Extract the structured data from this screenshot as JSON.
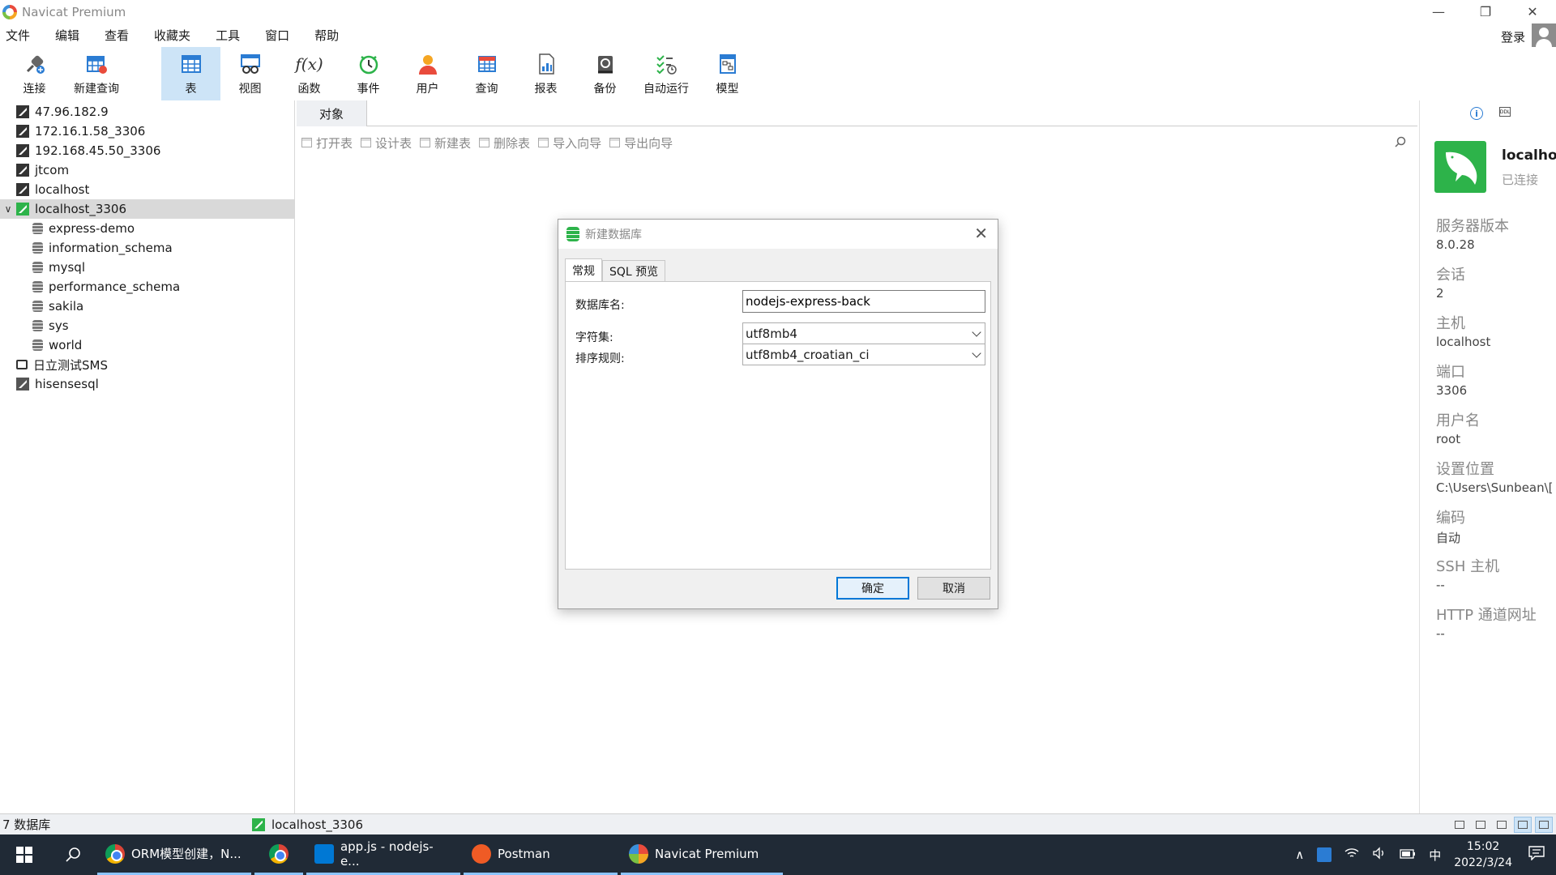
{
  "app": {
    "title": "Navicat Premium"
  },
  "window_controls": {
    "minimize": "—",
    "restore": "❐",
    "close": "✕"
  },
  "menu": {
    "items": [
      "文件",
      "编辑",
      "查看",
      "收藏夹",
      "工具",
      "窗口",
      "帮助"
    ],
    "login": "登录"
  },
  "toolbar": {
    "items": [
      {
        "label": "连接",
        "icon": "plug-icon"
      },
      {
        "label": "新建查询",
        "icon": "new-query-icon"
      },
      {
        "label": "表",
        "icon": "table-icon"
      },
      {
        "label": "视图",
        "icon": "view-icon"
      },
      {
        "label": "函数",
        "icon": "function-icon"
      },
      {
        "label": "事件",
        "icon": "clock-icon"
      },
      {
        "label": "用户",
        "icon": "user-icon"
      },
      {
        "label": "查询",
        "icon": "query-icon"
      },
      {
        "label": "报表",
        "icon": "report-icon"
      },
      {
        "label": "备份",
        "icon": "backup-icon"
      },
      {
        "label": "自动运行",
        "icon": "schedule-icon"
      },
      {
        "label": "模型",
        "icon": "model-icon"
      }
    ],
    "function_glyph": "f(x)"
  },
  "tree": {
    "connections": [
      "47.96.182.9",
      "172.16.1.58_3306",
      "192.168.45.50_3306",
      "jtcom",
      "localhost"
    ],
    "selected_connection": "localhost_3306",
    "databases": [
      "express-demo",
      "information_schema",
      "mysql",
      "performance_schema",
      "sakila",
      "sys",
      "world"
    ],
    "other_connections": [
      "日立测试SMS",
      "hisensesql"
    ]
  },
  "objects": {
    "tab_label": "对象",
    "actions": [
      "打开表",
      "设计表",
      "新建表",
      "删除表",
      "导入向导",
      "导出向导"
    ]
  },
  "info_panel": {
    "conn_name": "localho",
    "conn_status": "已连接",
    "items": [
      {
        "key": "服务器版本",
        "value": "8.0.28"
      },
      {
        "key": "会话",
        "value": "2"
      },
      {
        "key": "主机",
        "value": "localhost"
      },
      {
        "key": "端口",
        "value": "3306"
      },
      {
        "key": "用户名",
        "value": "root"
      },
      {
        "key": "设置位置",
        "value": "C:\\Users\\Sunbean\\["
      },
      {
        "key": "编码",
        "value": "自动"
      },
      {
        "key": "SSH 主机",
        "value": "--"
      },
      {
        "key": "HTTP 通道网址",
        "value": "--"
      }
    ]
  },
  "dialog": {
    "title": "新建数据库",
    "tabs": [
      "常规",
      "SQL 预览"
    ],
    "db_name_label": "数据库名:",
    "db_name_value": "nodejs-express-back",
    "charset_label": "字符集:",
    "charset_value": "utf8mb4",
    "collation_label": "排序规则:",
    "collation_value": "utf8mb4_croatian_ci",
    "ok": "确定",
    "cancel": "取消"
  },
  "statusbar": {
    "count": "7 数据库",
    "connection": "localhost_3306"
  },
  "taskbar": {
    "tasks": [
      {
        "label": "ORM模型创建，N...",
        "icon": "chrome-icon"
      },
      {
        "label": "",
        "icon": "chrome-icon"
      },
      {
        "label": "app.js - nodejs-e...",
        "icon": "vscode-icon"
      },
      {
        "label": "Postman",
        "icon": "postman-icon"
      },
      {
        "label": "Navicat Premium",
        "icon": "navicat-icon"
      }
    ],
    "ime": "中",
    "time": "15:02",
    "date": "2022/3/24"
  }
}
